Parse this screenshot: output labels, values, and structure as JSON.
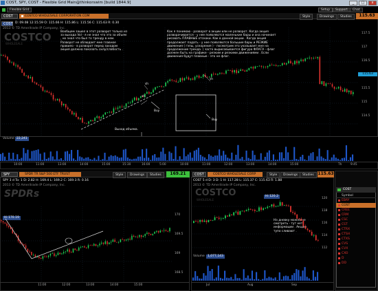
{
  "window": {
    "title": "COST, SPY, COST - Flexible Grid Main@thinkorswim [build 1844.9]",
    "btn_min": "_",
    "btn_max": "□",
    "btn_close": "x"
  },
  "menu": {
    "tab1": "Flexible Grid",
    "setup": "Setup",
    "support": "Support",
    "chat": "Chat"
  },
  "top": {
    "symbol": "COST",
    "company": "COSTCO WHOLESALE CORPORATION COM",
    "quote": "D: 09.08 12:15.59 O: 115.66 H: 115.86 L: 115.56 C: 115.63 R: 0.30",
    "gear": "Style",
    "drawings": "Drawings",
    "studies": "Studies",
    "price": "115.63",
    "copyright": "2013 © TD Ameritrade IP Company, Inc.",
    "logo": "COSTCO",
    "sub": "WHOLESALE",
    "volume_label": "Volume",
    "volume_value": "22,241",
    "axis_right": [
      "117.5",
      "117",
      "116.5",
      "116",
      "115.5",
      "115",
      "114.5"
    ],
    "time_labels": [
      "10:00",
      "11:00",
      "13:00",
      "14:00",
      "15:00",
      "15:30",
      "16:00",
      "5:00",
      "10:00",
      "11:00",
      "12:00",
      "13:00",
      "14:00",
      "15:00",
      "Th",
      "9:45"
    ],
    "note_left": "Вообщем зашел в этот разворот только из за выхода Vol - я не знал что это за объем , но знал что был то тренду в нем. Разворот не облюдает мне главное правило - в разворот перед заходом акция должна показать силу/слабость .",
    "note_right": "Как я понимаю - разворот в акции или не разворот. Когда акция разворачивается - у нее появляются маленькие бары и она начинает рисовать ПЛАВНЫЕ отскоки. Как в данной акции . Когда акция продолжает падать - у нее появляются большие бары и РЕЗКИЕ движения ( гэпы, ускорения ) - посмотрим это указывает мне на продолжение тренда. ( часто вырисовывается фигура ФЛАГА - флаг должен быть на графике - резким и резкими движениями . Если движения будут плавные - это не флаг.",
    "sh1": "sh",
    "sh2": "sh",
    "sh3": "sh",
    "buy1": "Buy",
    "buy2": "Buy",
    "vol_note": "Выход объема."
  },
  "spy": {
    "symbol": "SPY",
    "company": "SPDR TR S&P 500 ETF TRUST",
    "price": "169.21",
    "quote": "SPY 3 d To: 1 D: 2.82 H: 169.4 L: 169.2 C: 169.3 R: 0.16",
    "gear": "Style",
    "drawings": "Drawings",
    "studies": "Studies",
    "copyright": "2013 © TD Ameritrade IP Company, Inc.",
    "logo": "SPDRs",
    "hi": "Hi 170.19",
    "axis_right": [
      "170",
      "169.5",
      "169",
      "168.5"
    ],
    "time_labels": [
      "11:00",
      "12:00",
      "13:00",
      "14:00",
      "15:00"
    ]
  },
  "cost2": {
    "symbol": "COST",
    "company": "COSTCO WHOLESALE CORP",
    "price": "115.63",
    "quote": "COST 5 d D: 3 D: 1 H: 117.28 L: 115.37 C: 115.63 R: 1.88",
    "gear": "Style",
    "drawings": "Drawings",
    "studies": "Studies",
    "copyright": "2013 © TD Ameritrade IP Company, Inc.",
    "logo": "COSTCO",
    "sub": "WHOLESALE",
    "hi": "Hi 120.2",
    "note": "На дневку можно не смотреть - тут нет информации . Акцию тупо сливают .",
    "volume_label": "Volume",
    "volume_value": "1,077,143",
    "axis_right": [
      "120",
      "118",
      "116",
      "114",
      "112"
    ],
    "time_labels": [
      "Jul",
      "Aug",
      "Sep"
    ]
  },
  "watchlist": {
    "title": "COST",
    "header": "Symbol",
    "symbols": [
      "EBAY",
      "COST",
      "CREE",
      "CRM",
      "CSC",
      "CST",
      "CTRX",
      "CTSH",
      "CTXS",
      "CVS",
      "CVX",
      "CXO",
      "D",
      "DD"
    ],
    "selected": "COST"
  },
  "colors": {
    "orange": "#c9702a",
    "candle_up": "#1fd055",
    "candle_down": "#e0332f",
    "accent": "#21a0d8"
  }
}
